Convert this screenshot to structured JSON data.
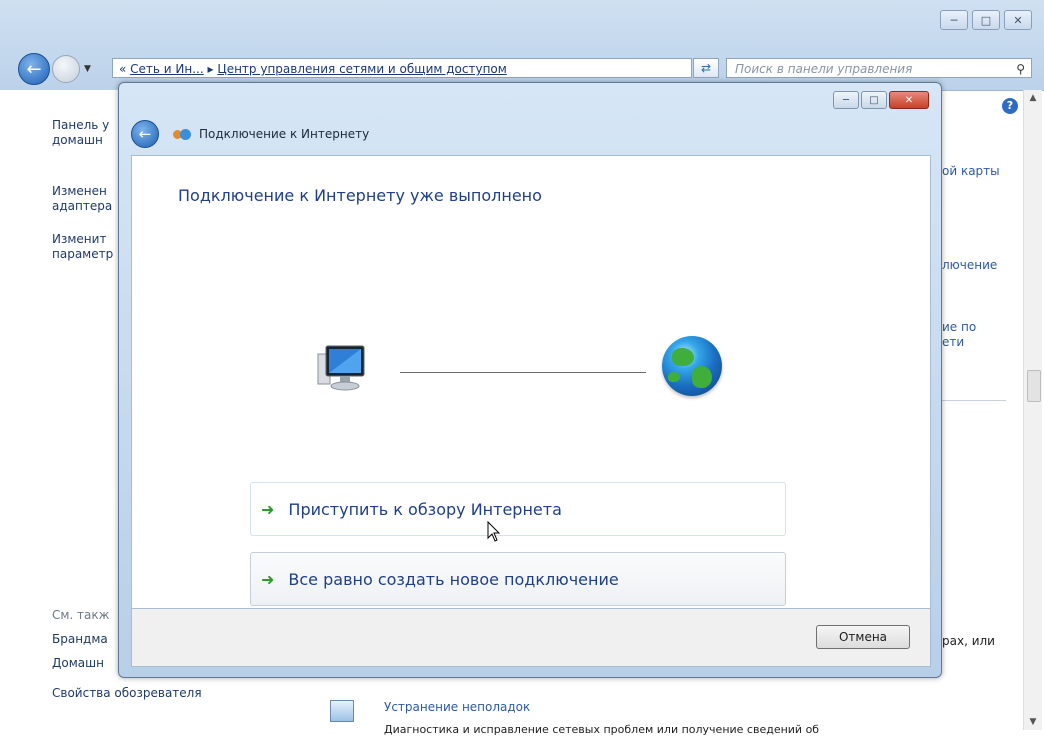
{
  "outer_window": {
    "address_prefix": "«",
    "breadcrumb_1": "Сеть и Ин...",
    "breadcrumb_sep": "▸",
    "breadcrumb_2": "Центр управления сетями и общим доступом",
    "search_placeholder": "Поиск в панели управления",
    "help_label": "?"
  },
  "left_pane": {
    "item_1_line1": "Панель у",
    "item_1_line2": "домашн",
    "item_2_line1": "Изменен",
    "item_2_line2": "адаптера",
    "item_3_line1": "Изменит",
    "item_3_line2": "параметр",
    "see_also": "См. такж",
    "link_1": "Брандма",
    "link_2": "Домашн",
    "link_3": "Свойства обозревателя"
  },
  "right_fragments": {
    "f1": "ой карты",
    "f2": "лючение",
    "f3_line1": "ие по",
    "f3_line2": "ети",
    "f4": "рах, или",
    "troubleshoot_title": "Устранение неполадок",
    "troubleshoot_desc": "Диагностика и исправление сетевых проблем или получение сведений об"
  },
  "dialog": {
    "title": "Подключение к Интернету",
    "heading": "Подключение к Интернету уже выполнено",
    "option_1": "Приступить к обзору Интернета",
    "option_2": "Все равно создать новое подключение",
    "cancel_label": "Отмена"
  }
}
